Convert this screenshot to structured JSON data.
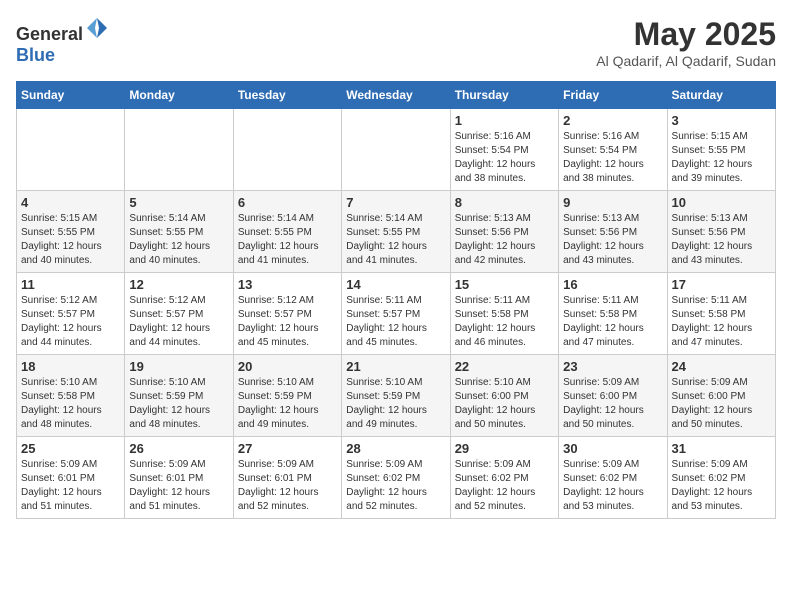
{
  "logo": {
    "general": "General",
    "blue": "Blue"
  },
  "header": {
    "month": "May 2025",
    "location": "Al Qadarif, Al Qadarif, Sudan"
  },
  "days_of_week": [
    "Sunday",
    "Monday",
    "Tuesday",
    "Wednesday",
    "Thursday",
    "Friday",
    "Saturday"
  ],
  "weeks": [
    [
      {
        "day": "",
        "info": ""
      },
      {
        "day": "",
        "info": ""
      },
      {
        "day": "",
        "info": ""
      },
      {
        "day": "",
        "info": ""
      },
      {
        "day": "1",
        "info": "Sunrise: 5:16 AM\nSunset: 5:54 PM\nDaylight: 12 hours\nand 38 minutes."
      },
      {
        "day": "2",
        "info": "Sunrise: 5:16 AM\nSunset: 5:54 PM\nDaylight: 12 hours\nand 38 minutes."
      },
      {
        "day": "3",
        "info": "Sunrise: 5:15 AM\nSunset: 5:55 PM\nDaylight: 12 hours\nand 39 minutes."
      }
    ],
    [
      {
        "day": "4",
        "info": "Sunrise: 5:15 AM\nSunset: 5:55 PM\nDaylight: 12 hours\nand 40 minutes."
      },
      {
        "day": "5",
        "info": "Sunrise: 5:14 AM\nSunset: 5:55 PM\nDaylight: 12 hours\nand 40 minutes."
      },
      {
        "day": "6",
        "info": "Sunrise: 5:14 AM\nSunset: 5:55 PM\nDaylight: 12 hours\nand 41 minutes."
      },
      {
        "day": "7",
        "info": "Sunrise: 5:14 AM\nSunset: 5:55 PM\nDaylight: 12 hours\nand 41 minutes."
      },
      {
        "day": "8",
        "info": "Sunrise: 5:13 AM\nSunset: 5:56 PM\nDaylight: 12 hours\nand 42 minutes."
      },
      {
        "day": "9",
        "info": "Sunrise: 5:13 AM\nSunset: 5:56 PM\nDaylight: 12 hours\nand 43 minutes."
      },
      {
        "day": "10",
        "info": "Sunrise: 5:13 AM\nSunset: 5:56 PM\nDaylight: 12 hours\nand 43 minutes."
      }
    ],
    [
      {
        "day": "11",
        "info": "Sunrise: 5:12 AM\nSunset: 5:57 PM\nDaylight: 12 hours\nand 44 minutes."
      },
      {
        "day": "12",
        "info": "Sunrise: 5:12 AM\nSunset: 5:57 PM\nDaylight: 12 hours\nand 44 minutes."
      },
      {
        "day": "13",
        "info": "Sunrise: 5:12 AM\nSunset: 5:57 PM\nDaylight: 12 hours\nand 45 minutes."
      },
      {
        "day": "14",
        "info": "Sunrise: 5:11 AM\nSunset: 5:57 PM\nDaylight: 12 hours\nand 45 minutes."
      },
      {
        "day": "15",
        "info": "Sunrise: 5:11 AM\nSunset: 5:58 PM\nDaylight: 12 hours\nand 46 minutes."
      },
      {
        "day": "16",
        "info": "Sunrise: 5:11 AM\nSunset: 5:58 PM\nDaylight: 12 hours\nand 47 minutes."
      },
      {
        "day": "17",
        "info": "Sunrise: 5:11 AM\nSunset: 5:58 PM\nDaylight: 12 hours\nand 47 minutes."
      }
    ],
    [
      {
        "day": "18",
        "info": "Sunrise: 5:10 AM\nSunset: 5:58 PM\nDaylight: 12 hours\nand 48 minutes."
      },
      {
        "day": "19",
        "info": "Sunrise: 5:10 AM\nSunset: 5:59 PM\nDaylight: 12 hours\nand 48 minutes."
      },
      {
        "day": "20",
        "info": "Sunrise: 5:10 AM\nSunset: 5:59 PM\nDaylight: 12 hours\nand 49 minutes."
      },
      {
        "day": "21",
        "info": "Sunrise: 5:10 AM\nSunset: 5:59 PM\nDaylight: 12 hours\nand 49 minutes."
      },
      {
        "day": "22",
        "info": "Sunrise: 5:10 AM\nSunset: 6:00 PM\nDaylight: 12 hours\nand 50 minutes."
      },
      {
        "day": "23",
        "info": "Sunrise: 5:09 AM\nSunset: 6:00 PM\nDaylight: 12 hours\nand 50 minutes."
      },
      {
        "day": "24",
        "info": "Sunrise: 5:09 AM\nSunset: 6:00 PM\nDaylight: 12 hours\nand 50 minutes."
      }
    ],
    [
      {
        "day": "25",
        "info": "Sunrise: 5:09 AM\nSunset: 6:01 PM\nDaylight: 12 hours\nand 51 minutes."
      },
      {
        "day": "26",
        "info": "Sunrise: 5:09 AM\nSunset: 6:01 PM\nDaylight: 12 hours\nand 51 minutes."
      },
      {
        "day": "27",
        "info": "Sunrise: 5:09 AM\nSunset: 6:01 PM\nDaylight: 12 hours\nand 52 minutes."
      },
      {
        "day": "28",
        "info": "Sunrise: 5:09 AM\nSunset: 6:02 PM\nDaylight: 12 hours\nand 52 minutes."
      },
      {
        "day": "29",
        "info": "Sunrise: 5:09 AM\nSunset: 6:02 PM\nDaylight: 12 hours\nand 52 minutes."
      },
      {
        "day": "30",
        "info": "Sunrise: 5:09 AM\nSunset: 6:02 PM\nDaylight: 12 hours\nand 53 minutes."
      },
      {
        "day": "31",
        "info": "Sunrise: 5:09 AM\nSunset: 6:02 PM\nDaylight: 12 hours\nand 53 minutes."
      }
    ]
  ]
}
